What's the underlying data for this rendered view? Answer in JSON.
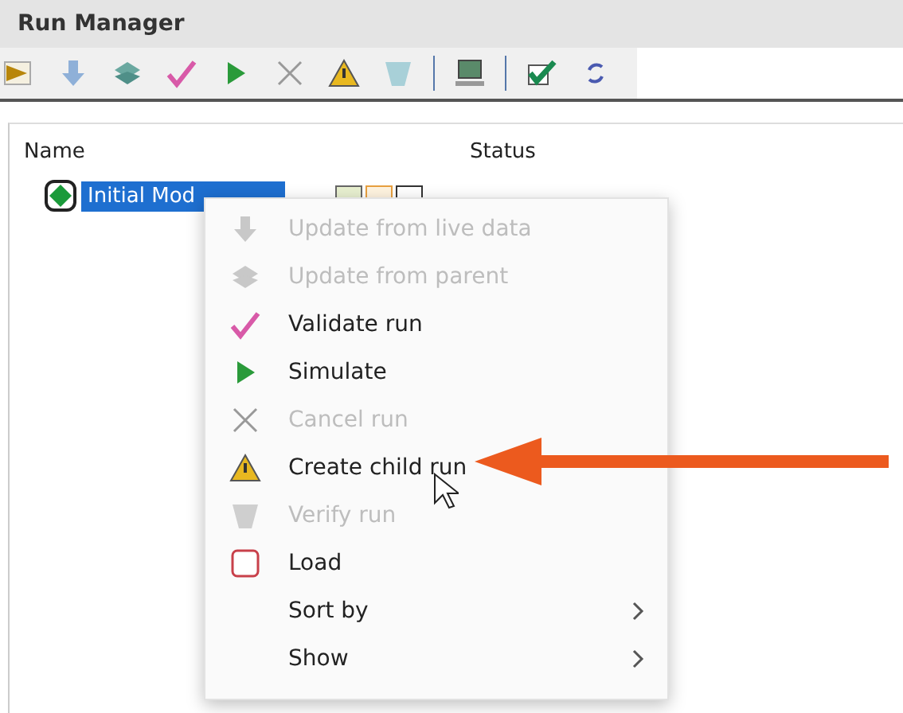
{
  "window": {
    "title": "Run Manager"
  },
  "toolbar": [
    {
      "kind": "play-box"
    },
    {
      "kind": "down"
    },
    {
      "kind": "stack"
    },
    {
      "kind": "check-pink"
    },
    {
      "kind": "play"
    },
    {
      "kind": "cross"
    },
    {
      "kind": "warn"
    },
    {
      "kind": "verify"
    },
    {
      "kind": "sep"
    },
    {
      "kind": "monitor"
    },
    {
      "kind": "sep"
    },
    {
      "kind": "check-box"
    },
    {
      "kind": "refresh"
    }
  ],
  "table": {
    "columns": [
      "Name",
      "Status"
    ],
    "rows": [
      {
        "name": "Initial Mod",
        "selected": true
      }
    ]
  },
  "menu": [
    {
      "label": "Update from live data",
      "kind": "down",
      "disabled": true,
      "submenu": false
    },
    {
      "label": "Update from parent",
      "kind": "stack",
      "disabled": true,
      "submenu": false
    },
    {
      "label": "Validate run",
      "kind": "check-pink",
      "disabled": false,
      "submenu": false
    },
    {
      "label": "Simulate",
      "kind": "play",
      "disabled": false,
      "submenu": false
    },
    {
      "label": "Cancel run",
      "kind": "cross",
      "disabled": true,
      "submenu": false
    },
    {
      "label": "Create child run",
      "kind": "warn",
      "disabled": false,
      "submenu": false
    },
    {
      "label": "Verify run",
      "kind": "verify",
      "disabled": true,
      "submenu": false
    },
    {
      "label": "Load",
      "kind": "square",
      "disabled": false,
      "submenu": false
    },
    {
      "label": "Sort by",
      "kind": "plain",
      "disabled": false,
      "submenu": true
    },
    {
      "label": "Show",
      "kind": "plain",
      "disabled": false,
      "submenu": true
    }
  ]
}
